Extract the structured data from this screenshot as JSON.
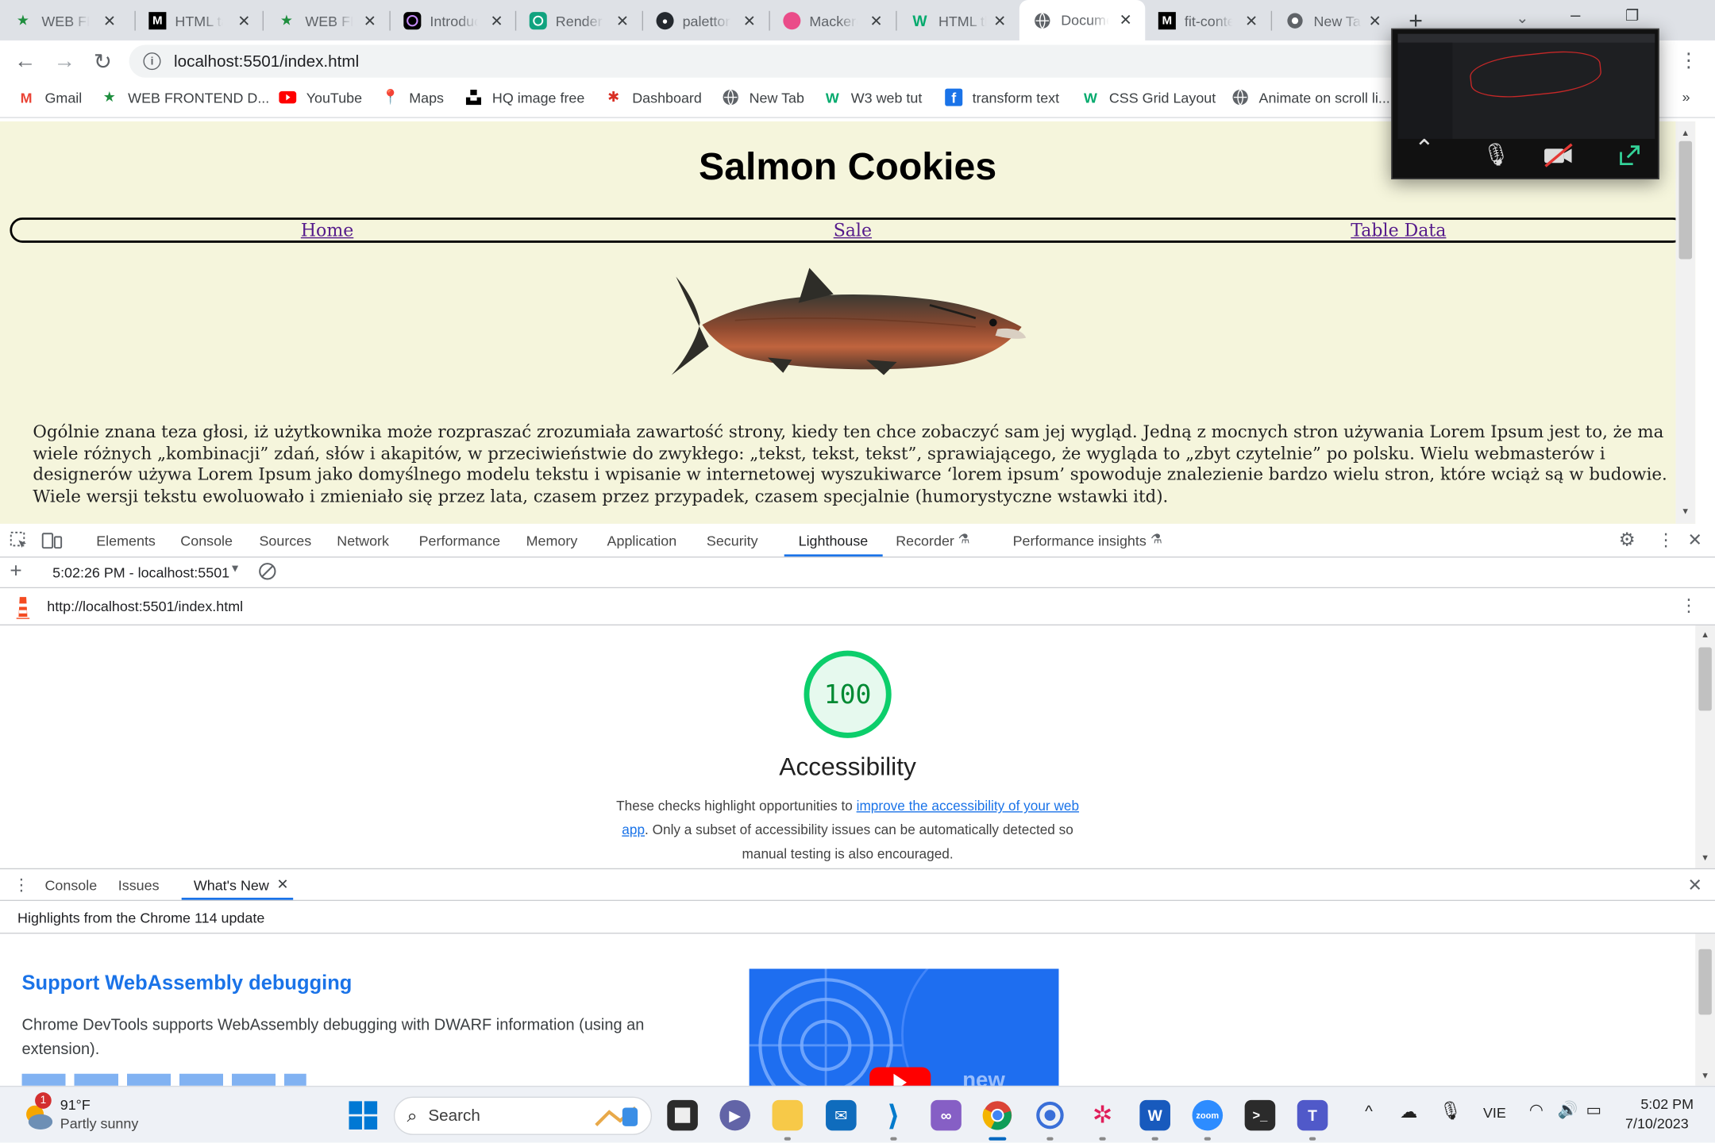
{
  "browser": {
    "tabs": [
      {
        "title": "WEB FRONTEND",
        "icon": "star-icon"
      },
      {
        "title": "HTML table",
        "icon": "medium-icon"
      },
      {
        "title": "WEB FRONTEND",
        "icon": "star-icon"
      },
      {
        "title": "Introduction",
        "icon": "openai-icon"
      },
      {
        "title": "Render",
        "icon": "chatgpt-icon"
      },
      {
        "title": "paletton",
        "icon": "github-icon"
      },
      {
        "title": "Mackerel",
        "icon": "dribbble-icon"
      },
      {
        "title": "HTML the",
        "icon": "w3schools-icon"
      },
      {
        "title": "Document",
        "icon": "globe-icon",
        "active": true
      },
      {
        "title": "fit-content",
        "icon": "medium-icon"
      },
      {
        "title": "New Tab",
        "icon": "chrome-icon"
      }
    ],
    "new_tab_glyph": "+",
    "url": "localhost:5501/index.html",
    "bookmarks": [
      {
        "label": "Gmail",
        "icon": "gmail-icon"
      },
      {
        "label": "WEB FRONTEND D...",
        "icon": "star-icon"
      },
      {
        "label": "YouTube",
        "icon": "youtube-icon"
      },
      {
        "label": "Maps",
        "icon": "maps-icon"
      },
      {
        "label": "HQ image free",
        "icon": "unsplash-icon"
      },
      {
        "label": "Dashboard",
        "icon": "dashboard-icon"
      },
      {
        "label": "New Tab",
        "icon": "globe-icon"
      },
      {
        "label": "W3 web tut",
        "icon": "w3schools-icon"
      },
      {
        "label": "transform text",
        "icon": "f-icon"
      },
      {
        "label": "CSS Grid Layout",
        "icon": "w3schools-icon"
      },
      {
        "label": "Animate on scroll li...",
        "icon": "globe-icon"
      }
    ],
    "bookmarks_more": "»"
  },
  "page": {
    "title": "Salmon Cookies",
    "nav": [
      "Home",
      "Sale",
      "Table Data"
    ],
    "paragraph": "Ogólnie znana teza głosi, iż użytkownika może rozpraszać zrozumiała zawartość strony, kiedy ten chce zobaczyć sam jej wygląd. Jedną z mocnych stron używania Lorem Ipsum jest to, że ma wiele różnych „kombinacji” zdań, słów i akapitów, w przeciwieństwie do zwykłego: „tekst, tekst, tekst”, sprawiającego, że wygląda to „zbyt czytelnie” po polsku. Wielu webmasterów i designerów używa Lorem Ipsum jako domyślnego modelu tekstu i wpisanie w internetowej wyszukiwarce ‘lorem ipsum’ spowoduje znalezienie bardzo wielu stron, które wciąż są w budowie. Wiele wersji tekstu ewoluowało i zmieniało się przez lata, czasem przez przypadek, czasem specjalnie (humorystyczne wstawki itd)."
  },
  "devtools": {
    "tabs": [
      "Elements",
      "Console",
      "Sources",
      "Network",
      "Performance",
      "Memory",
      "Application",
      "Security",
      "Lighthouse",
      "Recorder",
      "Performance insights"
    ],
    "active_tab": "Lighthouse",
    "report_selector": "5:02:26 PM - localhost:5501",
    "report_url": "http://localhost:5501/index.html",
    "score": "100",
    "category": "Accessibility",
    "description_before": "These checks highlight opportunities to ",
    "description_link": "improve the accessibility of your web app",
    "description_after": ". Only a subset of accessibility issues can be automatically detected so manual testing is also encouraged.",
    "drawer_tabs": [
      "Console",
      "Issues",
      "What's New"
    ],
    "drawer_active": "What's New",
    "drawer_header": "Highlights from the Chrome 114 update",
    "whatsnew_title": "Support WebAssembly debugging",
    "whatsnew_text": "Chrome DevTools supports WebAssembly debugging with DWARF information (using an extension)."
  },
  "taskbar": {
    "weather_temp": "91°F",
    "weather_desc": "Partly sunny",
    "weather_badge": "1",
    "search_placeholder": "Search",
    "language": "VIE",
    "time": "5:02 PM",
    "date": "7/10/2023",
    "apps": [
      "start-icon",
      "search",
      "file-icon",
      "video-chat-icon",
      "folder-icon",
      "mail-icon",
      "vscode-icon",
      "visual-studio-icon",
      "chrome-icon",
      "globe-icon",
      "slack-icon",
      "word-icon",
      "zoom-icon",
      "terminal-icon",
      "teams-icon"
    ],
    "colors": {
      "accent": "#1a73e8",
      "score_green": "#0cce6b"
    }
  }
}
